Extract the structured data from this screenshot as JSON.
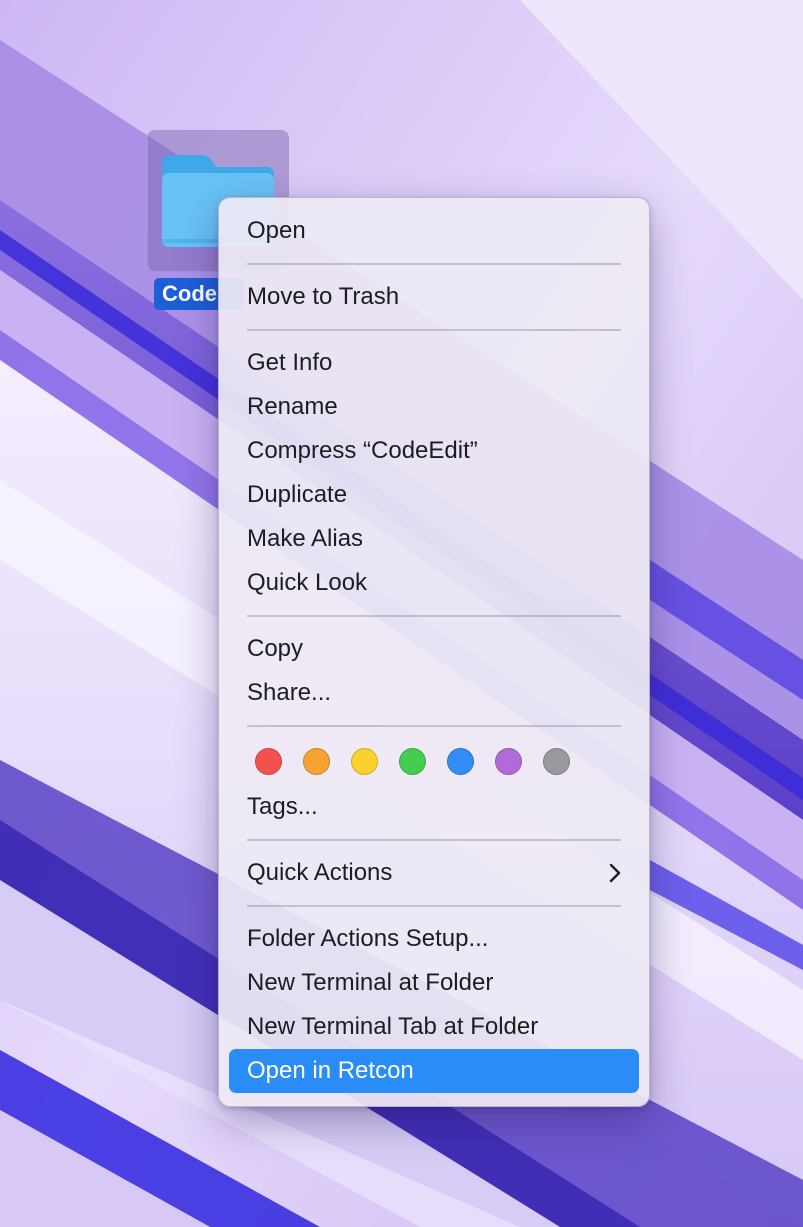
{
  "desktop": {
    "folder": {
      "label": "Code",
      "icon": "folder-icon"
    }
  },
  "menu": {
    "open": "Open",
    "move_to_trash": "Move to Trash",
    "get_info": "Get Info",
    "rename": "Rename",
    "compress": "Compress “CodeEdit”",
    "duplicate": "Duplicate",
    "make_alias": "Make Alias",
    "quick_look": "Quick Look",
    "copy": "Copy",
    "share": "Share...",
    "tags": "Tags...",
    "quick_actions": "Quick Actions",
    "folder_actions_setup": "Folder Actions Setup...",
    "new_terminal_at_folder": "New Terminal at Folder",
    "new_terminal_tab_at_folder": "New Terminal Tab at Folder",
    "open_in_retcon": "Open in Retcon"
  },
  "tag_colors": [
    {
      "name": "red",
      "color": "#f2524b"
    },
    {
      "name": "orange",
      "color": "#f7a233"
    },
    {
      "name": "yellow",
      "color": "#fbd22d"
    },
    {
      "name": "green",
      "color": "#45cc52"
    },
    {
      "name": "blue",
      "color": "#338df6"
    },
    {
      "name": "purple",
      "color": "#b26ad8"
    },
    {
      "name": "gray",
      "color": "#9a9a9e"
    }
  ],
  "colors": {
    "highlight": "#2a8cf7",
    "selection_label": "#1c5fd6"
  }
}
